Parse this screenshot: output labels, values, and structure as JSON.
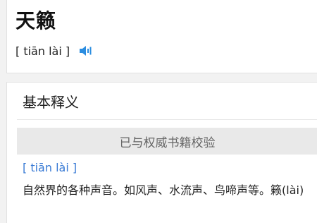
{
  "word": {
    "title": "天籁",
    "pinyin": "[ tiān lài ]",
    "speaker_icon": "speaker-icon"
  },
  "definition": {
    "section_title": "基本释义",
    "verify_banner": "已与权威书籍校验",
    "pinyin": "[ tiān lài ]",
    "text": "自然界的各种声音。如风声、水流声、鸟啼声等。籁(lài)",
    "accent_color": "#3a7bd5"
  }
}
